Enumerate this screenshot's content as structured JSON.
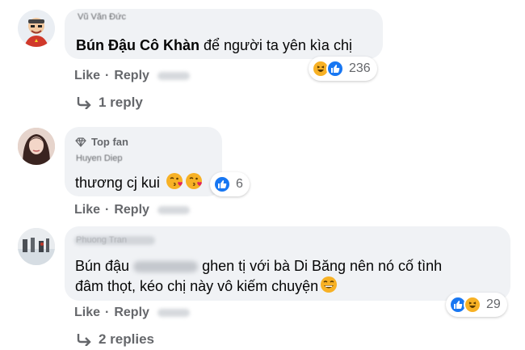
{
  "comments": [
    {
      "author_blurred": "Vũ Văn Đức",
      "text_bold": "Bún Đậu Cô Khàn",
      "text_rest": " để người ta yên kìa chị",
      "actions": {
        "like": "Like",
        "reply": "Reply"
      },
      "reaction_count": "236",
      "reaction_types": [
        "haha-icon",
        "like-icon"
      ],
      "replies_label": "1 reply"
    },
    {
      "badge": "Top fan",
      "author_blurred": "Huyen Diep",
      "text": "thương cj kui",
      "actions": {
        "like": "Like",
        "reply": "Reply"
      },
      "reaction_count": "6",
      "reaction_types": [
        "like-icon"
      ]
    },
    {
      "author_blurred": "Phuong Tran",
      "text_line1_a": "Bún đậu",
      "text_line1_b": "ghen tị với bà Di Băng nên nó cố tình",
      "text_line2": "đâm thọt, kéo chị này vô kiếm chuyện",
      "actions": {
        "like": "Like",
        "reply": "Reply"
      },
      "reaction_count": "29",
      "reaction_types": [
        "like-icon",
        "haha-icon"
      ],
      "replies_label": "2 replies"
    }
  ],
  "colors": {
    "bubble": "#f0f2f5",
    "secondary_text": "#65676b",
    "like_blue": "#1877f2",
    "haha_yellow": "#f7b125"
  }
}
